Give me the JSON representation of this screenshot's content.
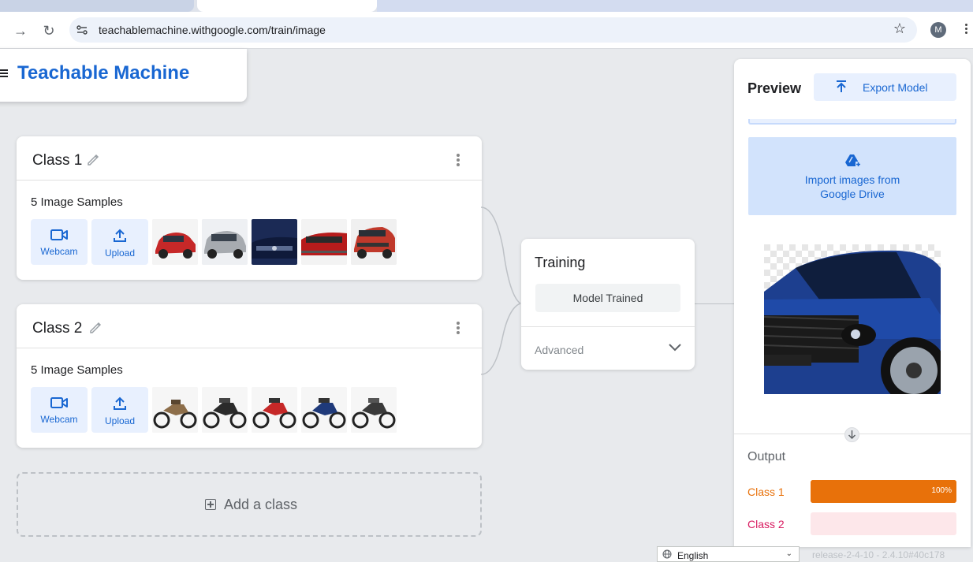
{
  "browser": {
    "url": "teachablemachine.withgoogle.com/train/image",
    "avatar_letter": "M"
  },
  "app": {
    "title": "Teachable Machine"
  },
  "classes": [
    {
      "name": "Class 1",
      "samples_label": "5 Image Samples",
      "webcam_label": "Webcam",
      "upload_label": "Upload",
      "thumb_colors": [
        "#c62828",
        "#9e9e9e",
        "#1a2a5a",
        "#b71c1c",
        "#c0392b"
      ]
    },
    {
      "name": "Class 2",
      "samples_label": "5 Image Samples",
      "webcam_label": "Webcam",
      "upload_label": "Upload",
      "thumb_colors": [
        "#8d6e4a",
        "#2b2b2b",
        "#c62828",
        "#1f3a7a",
        "#3a3a3a"
      ]
    }
  ],
  "add_class_label": "Add a class",
  "training": {
    "title": "Training",
    "button_label": "Model Trained",
    "advanced_label": "Advanced"
  },
  "preview": {
    "title": "Preview",
    "export_label": "Export Model",
    "import_line1": "Import images from",
    "import_line2": "Google Drive",
    "output_label": "Output",
    "outputs": [
      {
        "name": "Class 1",
        "percent": 100,
        "percent_label": "100%",
        "color": "#e8710a",
        "track_color": "#e8710a",
        "label_color": "#e8710a"
      },
      {
        "name": "Class 2",
        "percent": 0,
        "percent_label": "",
        "color": "#e52592",
        "track_color": "#fde7ea",
        "label_color": "#d81b60"
      }
    ]
  },
  "footer": {
    "language": "English",
    "release": "release-2-4-10 - 2.4.10#40c178"
  }
}
